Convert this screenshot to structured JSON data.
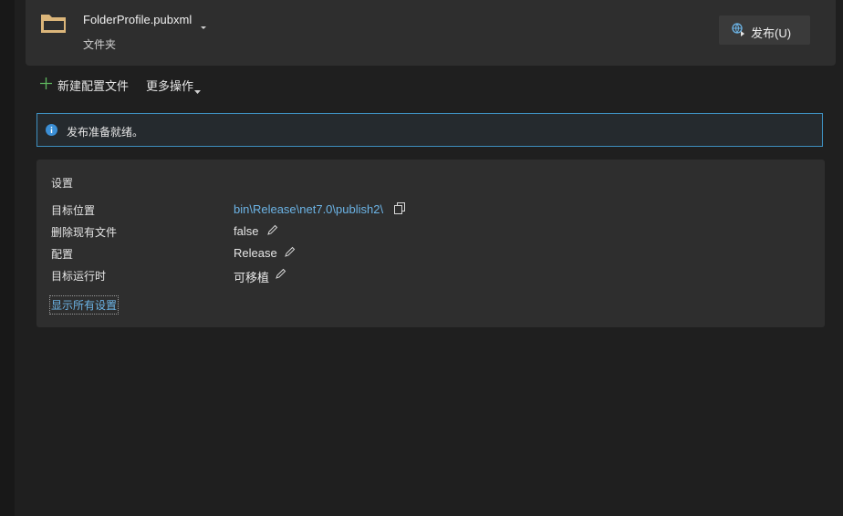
{
  "header": {
    "profile_name": "FolderProfile.pubxml",
    "profile_type": "文件夹",
    "publish_button": "发布(U)",
    "colors": {
      "folder": "#dcb67a",
      "accent": "#6cb4e6"
    }
  },
  "toolbar": {
    "new_profile_label": "新建配置文件",
    "more_actions_label": "更多操作"
  },
  "info_bar": {
    "text": "发布准备就绪。"
  },
  "settings": {
    "title": "设置",
    "rows": [
      {
        "label": "目标位置",
        "value": "bin\\Release\\net7.0\\publish2\\",
        "action_icon": "copy-icon"
      },
      {
        "label": "删除现有文件",
        "value": "false",
        "action_icon": "edit-icon"
      },
      {
        "label": "配置",
        "value": "Release",
        "action_icon": "edit-icon"
      },
      {
        "label": "目标运行时",
        "value": "可移植",
        "action_icon": "edit-icon"
      }
    ],
    "show_all_link": "显示所有设置"
  }
}
